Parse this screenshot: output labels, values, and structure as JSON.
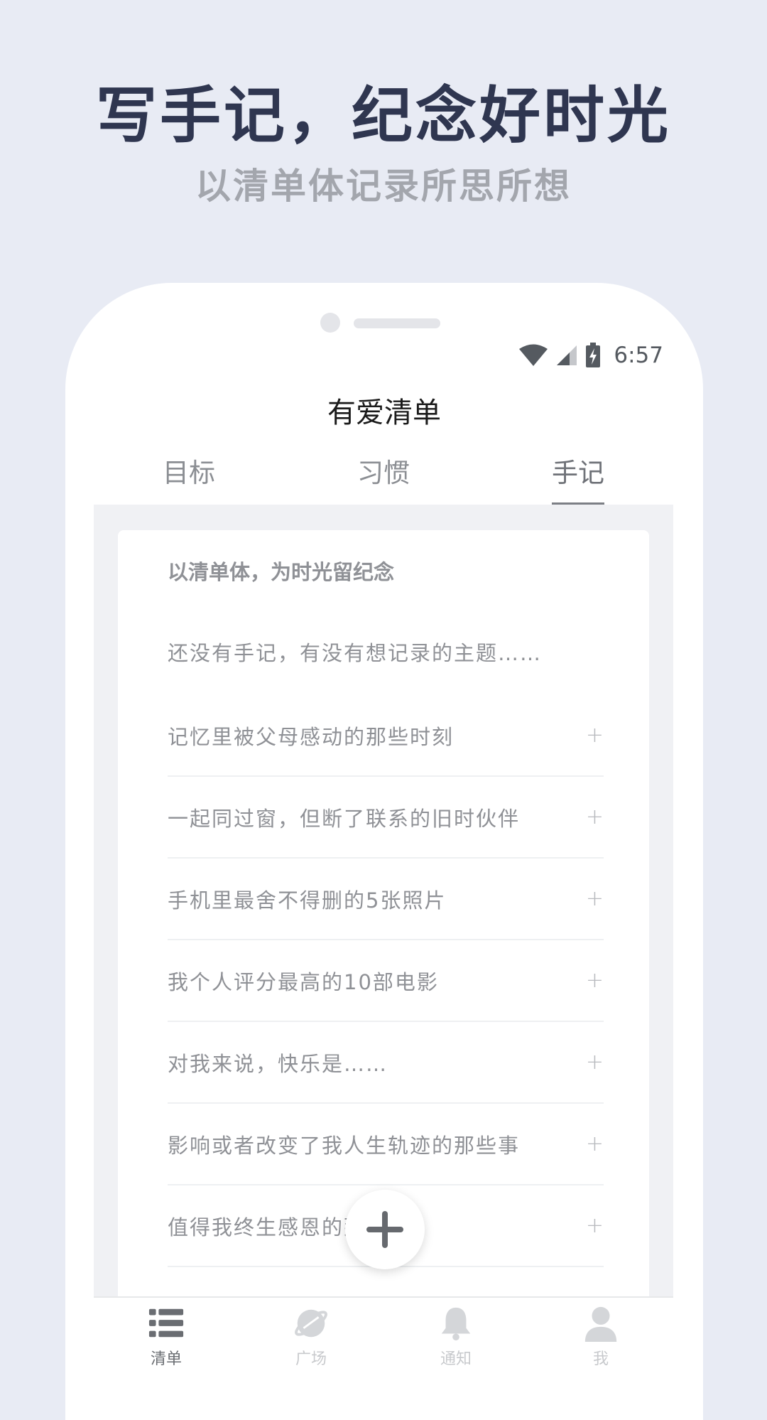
{
  "promo": {
    "title": "写手记，纪念好时光",
    "subtitle": "以清单体记录所思所想"
  },
  "status_bar": {
    "time": "6:57",
    "icons": [
      "wifi-icon",
      "signal-icon",
      "battery-charging-icon"
    ]
  },
  "app": {
    "title": "有爱清单"
  },
  "tabs": [
    {
      "label": "目标",
      "active": false
    },
    {
      "label": "习惯",
      "active": false
    },
    {
      "label": "手记",
      "active": true
    }
  ],
  "card": {
    "heading": "以清单体，为时光留纪念",
    "prompt": "还没有手记，有没有想记录的主题……",
    "topics": [
      {
        "text": "记忆里被父母感动的那些时刻",
        "action": "+"
      },
      {
        "text": "一起同过窗，但断了联系的旧时伙伴",
        "action": "+"
      },
      {
        "text": "手机里最舍不得删的5张照片",
        "action": "+"
      },
      {
        "text": "我个人评分最高的10部电影",
        "action": "+"
      },
      {
        "text": "对我来说，快乐是……",
        "action": "+"
      },
      {
        "text": "影响或者改变了我人生轨迹的那些事",
        "action": "+"
      },
      {
        "text": "值得我终生感恩的那些人",
        "action": "+"
      }
    ]
  },
  "bottom_nav": [
    {
      "label": "清单",
      "icon": "list-icon",
      "active": true
    },
    {
      "label": "广场",
      "icon": "planet-icon",
      "active": false
    },
    {
      "label": "通知",
      "icon": "bell-icon",
      "active": false
    },
    {
      "label": "我",
      "icon": "user-icon",
      "active": false
    }
  ],
  "colors": {
    "background": "#e8ebf4",
    "title": "#2f3650",
    "subtitle": "#a3a6ad",
    "text_muted": "#8f9196",
    "active_nav": "#6a6d72",
    "inactive_nav": "#c8cacd"
  }
}
